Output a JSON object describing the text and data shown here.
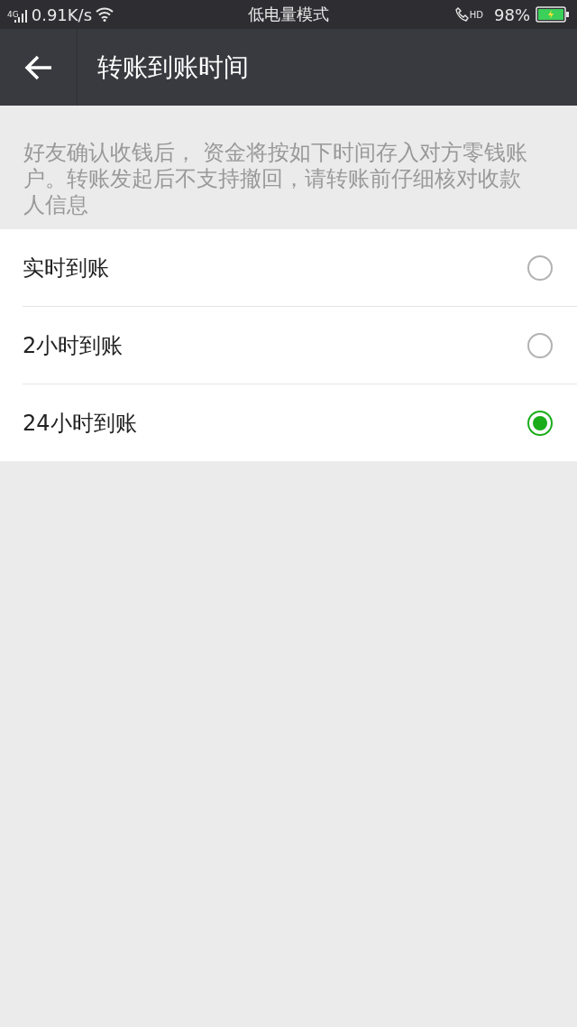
{
  "status_bar": {
    "network_type": "4G",
    "speed": "0.91K/s",
    "mode": "低电量模式",
    "call_badge": "HD",
    "battery": "98%"
  },
  "header": {
    "title": "转账到账时间"
  },
  "description": "好友确认收钱后， 资金将按如下时间存入对方零钱账户。转账发起后不支持撤回，请转账前仔细核对收款人信息",
  "options": [
    {
      "label": "实时到账",
      "selected": false
    },
    {
      "label": "2小时到账",
      "selected": false
    },
    {
      "label": "24小时到账",
      "selected": true
    }
  ]
}
